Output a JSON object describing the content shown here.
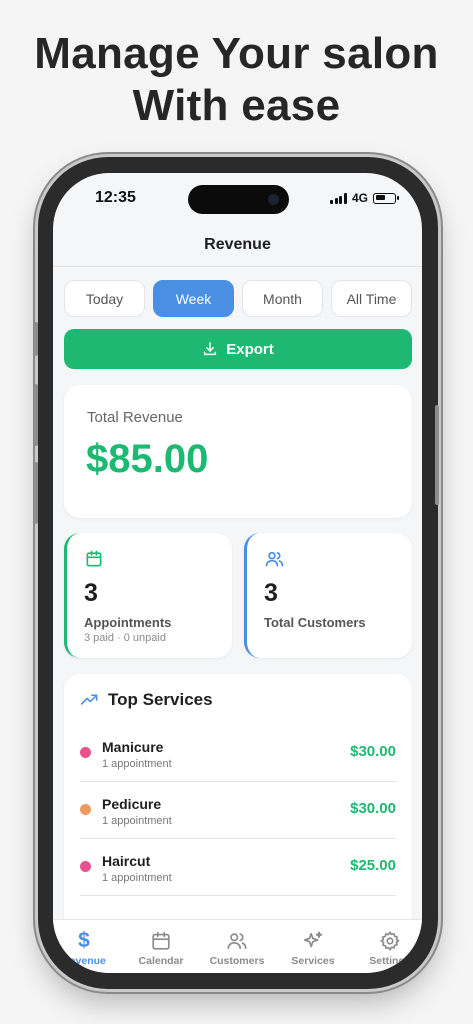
{
  "headline": {
    "line1": "Manage Your salon",
    "line2": "With ease"
  },
  "status_bar": {
    "time": "12:35",
    "network": "4G"
  },
  "nav": {
    "title": "Revenue"
  },
  "periods": [
    {
      "label": "Today",
      "active": false
    },
    {
      "label": "Week",
      "active": true
    },
    {
      "label": "Month",
      "active": false
    },
    {
      "label": "All Time",
      "active": false
    }
  ],
  "export": {
    "label": "Export",
    "icon": "download-icon"
  },
  "revenue": {
    "label": "Total Revenue",
    "amount": "$85.00"
  },
  "stats": {
    "appointments": {
      "value": "3",
      "label": "Appointments",
      "sub": "3 paid · 0 unpaid",
      "icon": "calendar-icon"
    },
    "customers": {
      "value": "3",
      "label": "Total Customers",
      "icon": "users-icon"
    }
  },
  "top_services": {
    "title": "Top Services",
    "icon": "trending-up-icon",
    "items": [
      {
        "name": "Manicure",
        "count": "1 appointment",
        "price": "$30.00",
        "color": "#e8538f"
      },
      {
        "name": "Pedicure",
        "count": "1 appointment",
        "price": "$30.00",
        "color": "#ee9a63"
      },
      {
        "name": "Haircut",
        "count": "1 appointment",
        "price": "$25.00",
        "color": "#e8538f"
      }
    ]
  },
  "tabbar": [
    {
      "label": "Revenue",
      "icon": "dollar-icon",
      "active": true
    },
    {
      "label": "Calendar",
      "icon": "calendar-icon",
      "active": false
    },
    {
      "label": "Customers",
      "icon": "users-icon",
      "active": false
    },
    {
      "label": "Services",
      "icon": "sparkles-icon",
      "active": false
    },
    {
      "label": "Settings",
      "icon": "gear-icon",
      "active": false
    }
  ],
  "colors": {
    "accent_blue": "#4a8fe2",
    "accent_green": "#1db872"
  }
}
